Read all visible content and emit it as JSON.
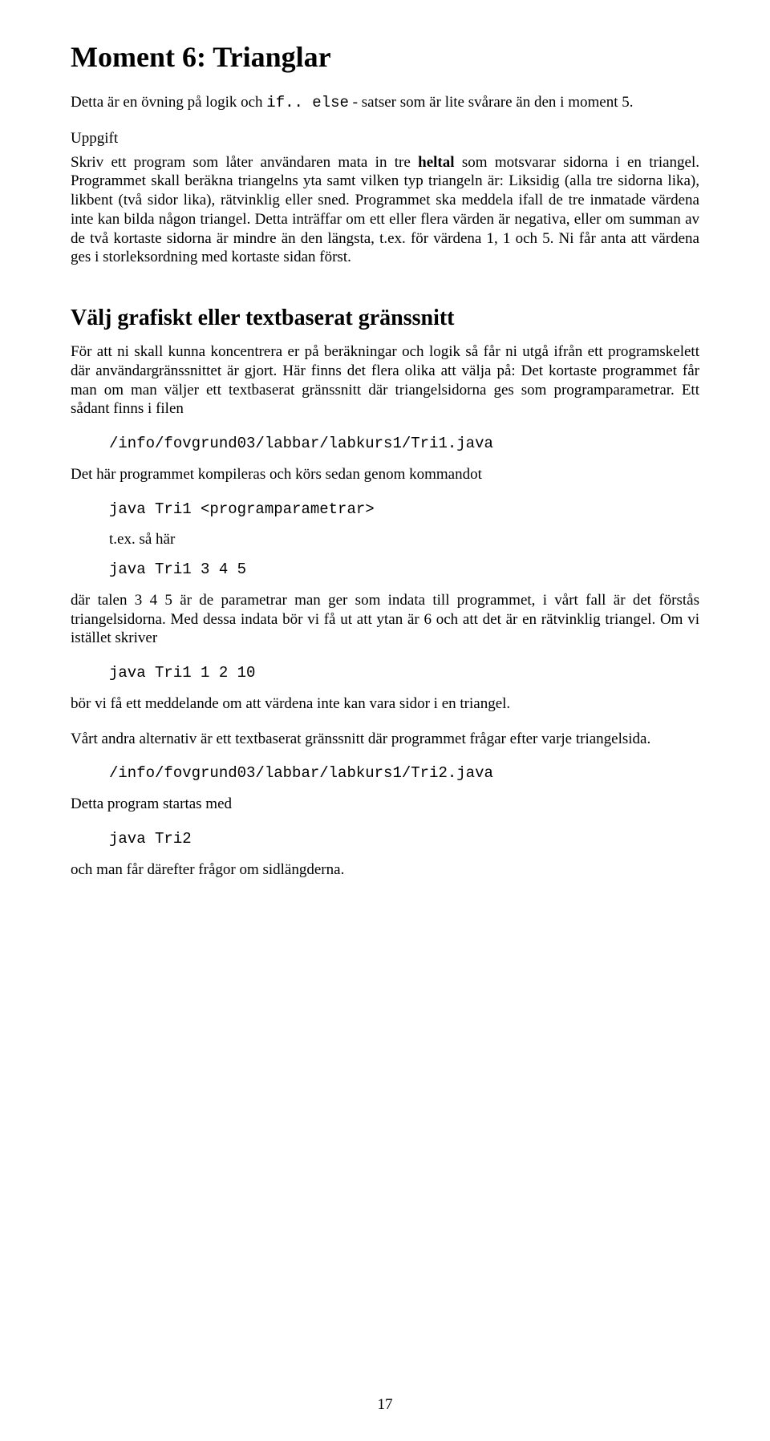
{
  "title": "Moment 6: Trianglar",
  "intro": "Detta är en övning på logik och if.. else - satser som är lite svårare än den i moment 5.",
  "uppgift_heading": "Uppgift",
  "uppgift_p1_a": "Skriv ett program som låter användaren mata in tre ",
  "uppgift_p1_b_bold": "heltal",
  "uppgift_p1_c": " som motsvarar sidorna i en triangel. Programmet skall beräkna triangelns yta samt vilken typ triangeln är: Liksidig (alla tre sidorna lika), likbent (två sidor lika), rätvinklig eller sned. Programmet ska meddela ifall de tre inmatade värdena inte kan bilda någon triangel. Detta inträffar om ett eller flera värden är negativa, eller om summan av de två kortaste sidorna är mindre än den längsta, t.ex. för värdena 1, 1 och 5. Ni får anta att värdena ges i storleksordning med kortaste sidan först.",
  "section2_heading": "Välj grafiskt eller textbaserat gränssnitt",
  "section2_p1": "För att ni skall kunna koncentrera er på beräkningar och logik så får ni utgå ifrån ett programskelett där användargränssnittet är gjort. Här finns det flera olika att välja på: Det kortaste programmet får man om man väljer ett textbaserat gränssnitt där triangelsidorna ges som programparametrar. Ett sådant finns i filen",
  "code_path1": "/info/fovgrund03/labbar/labkurs1/Tri1.java",
  "section2_p2": "Det här programmet kompileras och körs sedan genom kommandot",
  "code_cmd1": "java Tri1 <programparametrar>",
  "tex_line": "t.ex. så här",
  "code_cmd2": "java Tri1 3 4 5",
  "section2_p3": "där talen 3 4 5 är de parametrar man ger som indata till programmet, i vårt fall är det förstås triangelsidorna. Med dessa indata bör vi få ut att ytan är 6 och att det är en rätvinklig triangel. Om vi istället skriver",
  "code_cmd3": "java Tri1 1 2 10",
  "section2_p4": "bör vi få ett meddelande om att värdena inte kan vara sidor i en triangel.",
  "section2_p5": "Vårt andra alternativ är ett textbaserat gränssnitt där programmet frågar efter varje triangelsida.",
  "code_path2": "/info/fovgrund03/labbar/labkurs1/Tri2.java",
  "section2_p6": "Detta program startas med",
  "code_cmd4": "java Tri2",
  "section2_p7": "och man får därefter frågor om sidlängderna.",
  "page_number": "17"
}
